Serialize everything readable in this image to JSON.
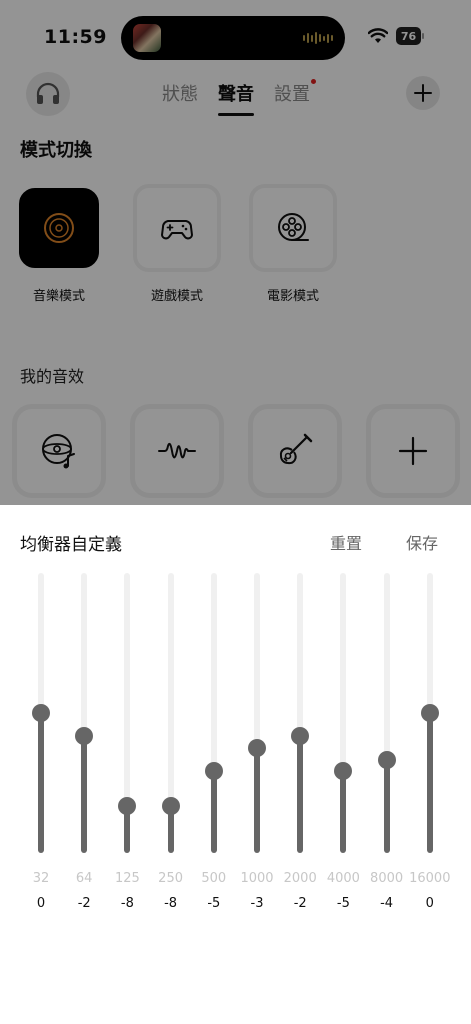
{
  "status_bar": {
    "time": "11:59",
    "battery": "76"
  },
  "header": {
    "tabs": [
      {
        "label": "狀態",
        "active": false,
        "badge": false
      },
      {
        "label": "聲音",
        "active": true,
        "badge": false
      },
      {
        "label": "設置",
        "active": false,
        "badge": true
      }
    ],
    "avatar_icon": "headphones-icon",
    "add_icon": "plus-icon"
  },
  "mode_section": {
    "title": "模式切換",
    "modes": [
      {
        "label": "音樂模式",
        "icon": "vinyl-disc-icon",
        "active": true
      },
      {
        "label": "遊戲模式",
        "icon": "gamepad-icon",
        "active": false
      },
      {
        "label": "電影模式",
        "icon": "film-reel-icon",
        "active": false
      }
    ]
  },
  "effects_section": {
    "title": "我的音效",
    "effects": [
      {
        "icon": "disc-music-icon"
      },
      {
        "icon": "sound-wave-icon"
      },
      {
        "icon": "guitar-icon"
      },
      {
        "icon": "plus-icon"
      }
    ]
  },
  "equalizer": {
    "title": "均衡器自定義",
    "reset_label": "重置",
    "save_label": "保存",
    "range": [
      -12,
      12
    ],
    "bands": [
      {
        "freq": "32",
        "gain": 0
      },
      {
        "freq": "64",
        "gain": -2
      },
      {
        "freq": "125",
        "gain": -8
      },
      {
        "freq": "250",
        "gain": -8
      },
      {
        "freq": "500",
        "gain": -5
      },
      {
        "freq": "1000",
        "gain": -3
      },
      {
        "freq": "2000",
        "gain": -2
      },
      {
        "freq": "4000",
        "gain": -5
      },
      {
        "freq": "8000",
        "gain": -4
      },
      {
        "freq": "16000",
        "gain": 0
      }
    ]
  },
  "colors": {
    "accent": "#e0862a",
    "slider": "#666666",
    "overlay": "rgba(0,0,0,0.42)"
  }
}
